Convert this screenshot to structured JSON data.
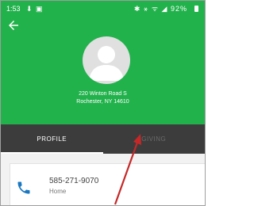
{
  "status_bar": {
    "time": "1:53",
    "left_icons": "⬇ ▣",
    "right_icons": "✱ ⚹ ᯤ ◢",
    "battery_text": "92%"
  },
  "profile": {
    "address_line1": "220 Winton Road S",
    "address_line2": "Rochester, NY 14610"
  },
  "tabs": [
    {
      "label": "PROFILE",
      "selected": true
    },
    {
      "label": "GIVING",
      "selected": false
    }
  ],
  "contact": {
    "phone_number": "585-271-9070",
    "phone_type": "Home"
  },
  "colors": {
    "header_green": "#22b24c",
    "tab_bar": "#3c3c3c",
    "phone_icon": "#1a78c2",
    "annotation_arrow": "#c62828"
  }
}
